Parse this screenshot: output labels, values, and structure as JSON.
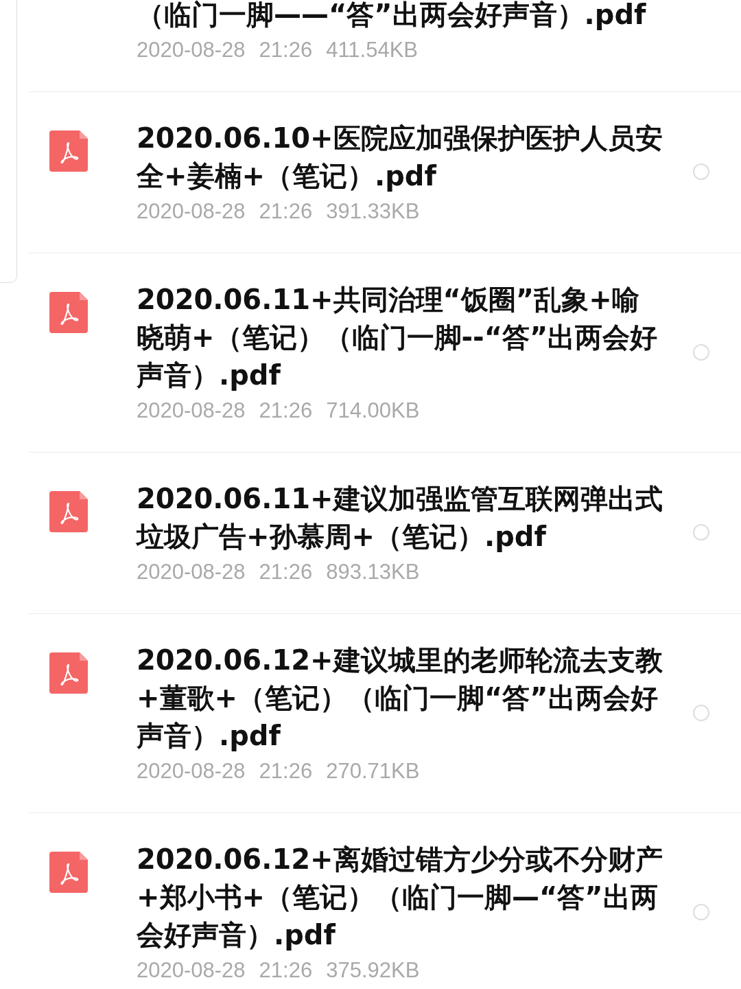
{
  "files": [
    {
      "kind": "cut",
      "title": "（临门一脚——“答”出两会好声音）.pdf",
      "date": "2020-08-28",
      "time": "21:26",
      "size": "411.54KB"
    },
    {
      "kind": "file",
      "title": "2020.06.10+医院应加强保护医护人员安全+姜楠+（笔记）.pdf",
      "date": "2020-08-28",
      "time": "21:26",
      "size": "391.33KB",
      "selected": false
    },
    {
      "kind": "file",
      "title": "2020.06.11+共同治理“饭圈”乱象+喻晓萌+（笔记）（临门一脚--“答”出两会好声音）.pdf",
      "date": "2020-08-28",
      "time": "21:26",
      "size": "714.00KB",
      "selected": false
    },
    {
      "kind": "file",
      "title": "2020.06.11+建议加强监管互联网弹出式垃圾广告+孙慕周+（笔记）.pdf",
      "date": "2020-08-28",
      "time": "21:26",
      "size": "893.13KB",
      "selected": false
    },
    {
      "kind": "file",
      "title": "2020.06.12+建议城里的老师轮流去支教+董歌+（笔记）（临门一脚“答”出两会好声音）.pdf",
      "date": "2020-08-28",
      "time": "21:26",
      "size": "270.71KB",
      "selected": false
    },
    {
      "kind": "file",
      "title": "2020.06.12+离婚过错方少分或不分财产+郑小书+（笔记）（临门一脚—“答”出两会好声音）.pdf",
      "date": "2020-08-28",
      "time": "21:26",
      "size": "375.92KB",
      "selected": false
    }
  ]
}
